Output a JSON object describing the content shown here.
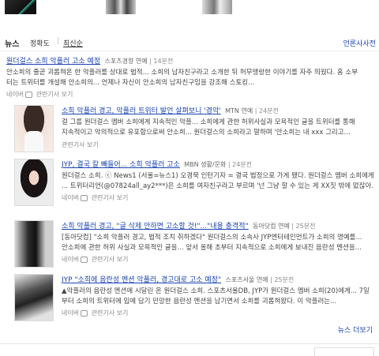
{
  "tabs": {
    "title": "뉴스",
    "sort_accuracy": "정확도",
    "sort_latest": "최신순",
    "press_dictionary": "언론사사전"
  },
  "articles": [
    {
      "title": "원더걸스 소희 악플러 고소 예정",
      "source": "스포츠경향 연예",
      "time": "14분전",
      "desc1": "안소희의 줄곧 괴롭혀온 한 악플러를 상대로 법적... 소희의 남자친구라고 소개한 뒤 허무맹랑한 이야기를 자주 띄웠다. 홈 소부",
      "desc2": "터는 트위터를 개설해 안소희의... 언제나 자신이 안소희의 남자친구임을 강조해 스토킹...",
      "naver": "네이버",
      "related": "관련기사 보기"
    },
    {
      "title": "소희 악플러 경고, 악플러 트위터 발언 살펴보니 '경악'",
      "source": "MTN 연예",
      "time": "24분전",
      "desc1": "걸 그룹 원더걸스 멤버 소희에게 지속적인 악플... 소희에게 관한 허위사실과 모욕적인 글을 트위터를 통해",
      "desc2": "지속적이고 악의적으로 유포함으로써 안소희... 원더걸스의 소희라고 말하며 '안소희는 내 xxx 그리고...",
      "related": "관련기사 보기"
    },
    {
      "title": "JYP, 결국 칼 빼들어... 소희 악플러 고소",
      "source": "MBN 생활/문화",
      "time": "24분전",
      "desc1": "원더걸스 소희. ⓒ News1 (서울=뉴스1) 오경묵 인턴기자 = 결국 법정으로 가게 됐다. 원더걸스 멤버 소희에게",
      "desc2": "... 트위터리언(@07824all_ay2***)은 소희를 여자친구라고 부르며 '넌 그냥 할 수 있는 게 XX짓 밖에 없잖아.",
      "naver": "네이버",
      "related": "관련기사 보기"
    },
    {
      "title": "소희 악플러 경고, \"글 삭제 안하면 고소할 것!\"...\"내용 충격적\"",
      "source": "동아닷컴 연예",
      "time": "25분전",
      "desc1": "[동아닷컴] \"소희 악플러 경고, 법적 조치 취하겠다\" 원더걸스의 소속사 JYP엔터테인먼트가 소희의 명예를...",
      "desc2": "안소희에 관한 허위 사실과 모욕적인 글을... 앞서 올해 초부터 지속적으로 소희에게 보내진 음란성 멘션을...",
      "naver": "네이버",
      "related": "관련기사 보기"
    },
    {
      "title": "JYP \"소희에 음란성 멘션 악플러, 경고대로 고소 예정\"",
      "source": "스포츠서울 연예",
      "time": "25분전",
      "desc1": "▲악플러의 음란성 멘션에 시달린 온 원더걸스 소희. 스포츠서울DB, JYP가 원더걸스 멤버 소희(20)에게... 7일",
      "desc2": "부터 소희의 트위터에 입에 담기 민망한 음란성 멘션을 남기면서 소희를 괴롭혀왔다. 이 악플러는...",
      "naver": "네이버",
      "related": "관련기사 보기"
    }
  ],
  "more_news": "뉴스 더보기"
}
